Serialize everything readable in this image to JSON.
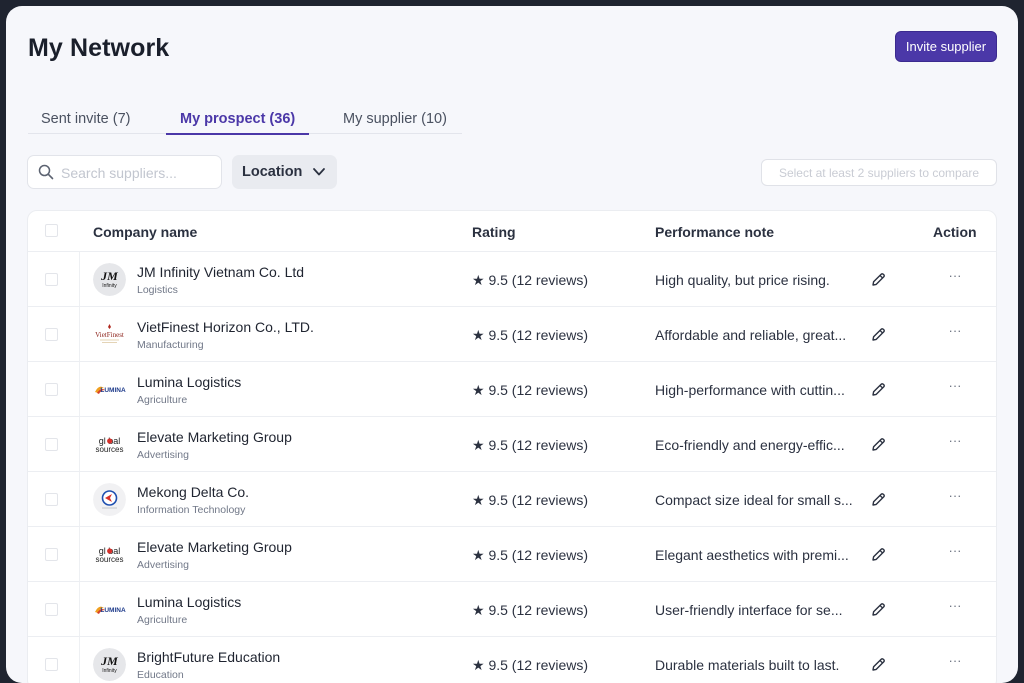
{
  "header": {
    "title": "My Network",
    "invite_label": "Invite supplier"
  },
  "tabs": [
    {
      "label": "Sent invite (7)"
    },
    {
      "label": "My prospect (36)"
    },
    {
      "label": "My supplier (10)"
    }
  ],
  "active_tab": "My prospect (36)",
  "toolbar": {
    "search_placeholder": "Search suppliers...",
    "location_label": "Location",
    "compare_label": "Select at least 2 suppliers to compare"
  },
  "table": {
    "columns": [
      "Company name",
      "Rating",
      "Performance note",
      "Action"
    ],
    "rows": [
      {
        "company": "JM Infinity Vietnam Co. Ltd",
        "industry": "Logistics",
        "rating": "★ 9.5 (12 reviews)",
        "note": "High quality, but price rising.",
        "logo": "jm-infinity-logo",
        "more": "···"
      },
      {
        "company": "VietFinest Horizon Co., LTD.",
        "industry": "Manufacturing",
        "rating": "★ 9.5 (12 reviews)",
        "note": "Affordable and reliable, great...",
        "logo": "vietfinest-logo",
        "more": "···"
      },
      {
        "company": "Lumina Logistics",
        "industry": "Agriculture",
        "rating": "★ 9.5 (12 reviews)",
        "note": "High-performance with cuttin...",
        "logo": "lumina-logo",
        "more": "···"
      },
      {
        "company": "Elevate Marketing Group",
        "industry": "Advertising",
        "rating": "★ 9.5 (12 reviews)",
        "note": "Eco-friendly and energy-effic...",
        "logo": "global-sources-logo",
        "more": "···"
      },
      {
        "company": "Mekong Delta Co.",
        "industry": "Information Technology",
        "rating": "★ 9.5 (12 reviews)",
        "note": "Compact size ideal for small s...",
        "logo": "mekong-delta-logo",
        "more": "···"
      },
      {
        "company": "Elevate Marketing Group",
        "industry": "Advertising",
        "rating": "★ 9.5 (12 reviews)",
        "note": "Elegant aesthetics with premi...",
        "logo": "global-sources-logo",
        "more": "···"
      },
      {
        "company": "Lumina Logistics",
        "industry": "Agriculture",
        "rating": "★ 9.5 (12 reviews)",
        "note": "User-friendly interface for se...",
        "logo": "lumina-logo",
        "more": "···"
      },
      {
        "company": "BrightFuture Education",
        "industry": "Education",
        "rating": "★ 9.5 (12 reviews)",
        "note": "Durable materials built to last.",
        "logo": "jm-infinity-logo",
        "more": "···"
      }
    ]
  },
  "logos": {
    "jm": {
      "main": "JM",
      "sub": "Infinity"
    },
    "vietfinest": {
      "main": "VietFinest"
    },
    "lumina": {
      "main": "LUMINA"
    },
    "global": {
      "line1": "gl bal",
      "line2": "sources"
    }
  },
  "colors": {
    "accent": "#4b38a8",
    "background": "#f6f7fb"
  }
}
